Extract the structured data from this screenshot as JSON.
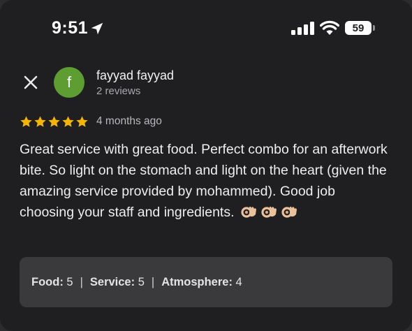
{
  "status_bar": {
    "time": "9:51",
    "battery": "59"
  },
  "review": {
    "avatar_letter": "f",
    "avatar_color": "#5e9d32",
    "reviewer_name": "fayyad fayyad",
    "review_count": "2 reviews",
    "star_rating": 5,
    "star_color": "#f4b400",
    "time_ago": "4 months ago",
    "text": "Great service with great food. Perfect combo for an afterwork bite. So light on the stomach and light on the heart (given the amazing service provided by mohammed). Good job choosing your staff and ingredients.",
    "emojis": [
      "ok-hand-emoji",
      "ok-hand-emoji",
      "ok-hand-emoji"
    ]
  },
  "subratings": [
    {
      "label": "Food:",
      "value": "5"
    },
    {
      "label": "Service:",
      "value": "5"
    },
    {
      "label": "Atmosphere:",
      "value": "4"
    }
  ]
}
